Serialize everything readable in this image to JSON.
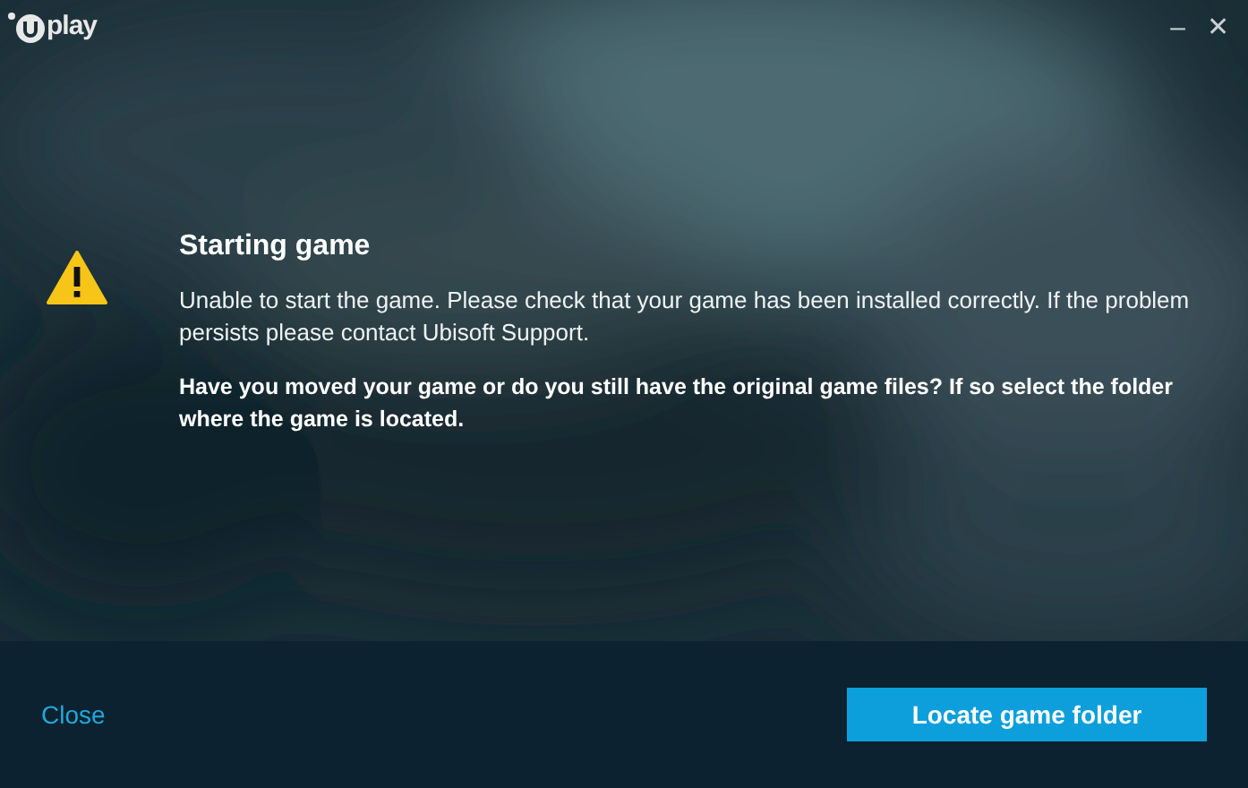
{
  "window": {
    "logo_text": "play",
    "minimize": "–",
    "close": "✕"
  },
  "dialog": {
    "title": "Starting game",
    "message": "Unable to start the game. Please check that your game has been installed correctly. If the problem persists please contact Ubisoft Support.",
    "question": "Have you moved your game or do you still have the original game files? If so select the folder where the game is located."
  },
  "footer": {
    "close_link": "Close",
    "primary_button": "Locate game folder"
  }
}
